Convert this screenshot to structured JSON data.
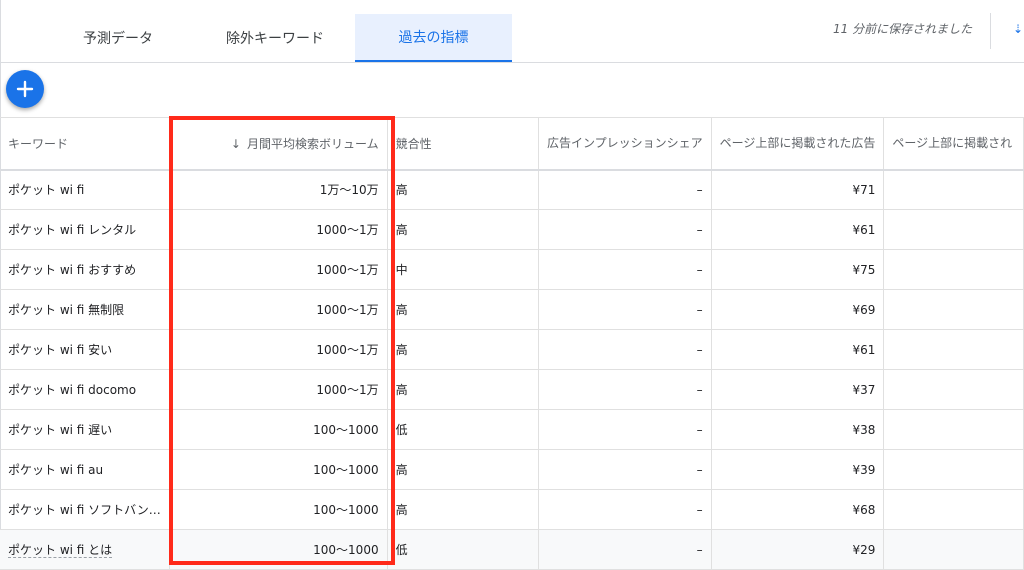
{
  "tabs": [
    {
      "label": "予測データ"
    },
    {
      "label": "除外キーワード"
    },
    {
      "label": "過去の指標"
    }
  ],
  "saved_status": "11 分前に保存されました",
  "colors": {
    "accent": "#1a73e8",
    "highlight": "#ff2a1a",
    "active_tab_bg": "#e8f0fe"
  },
  "table": {
    "headers": {
      "keyword": "キーワード",
      "volume": "月間平均検索ボリューム",
      "competition": "競合性",
      "impression_share": "広告インプレッションシェア",
      "top_bid_low": "ページ上部に掲載された広告",
      "top_bid_high": "ページ上部に掲載され"
    },
    "sort_icon": "arrow-down-icon",
    "rows": [
      {
        "keyword": "ポケット wi fi",
        "volume": "1万〜10万",
        "competition": "高",
        "share": "–",
        "bid": "¥71"
      },
      {
        "keyword": "ポケット wi fi レンタル",
        "volume": "1000〜1万",
        "competition": "高",
        "share": "–",
        "bid": "¥61"
      },
      {
        "keyword": "ポケット wi fi おすすめ",
        "volume": "1000〜1万",
        "competition": "中",
        "share": "–",
        "bid": "¥75"
      },
      {
        "keyword": "ポケット wi fi 無制限",
        "volume": "1000〜1万",
        "competition": "高",
        "share": "–",
        "bid": "¥69"
      },
      {
        "keyword": "ポケット wi fi 安い",
        "volume": "1000〜1万",
        "competition": "高",
        "share": "–",
        "bid": "¥61"
      },
      {
        "keyword": "ポケット wi fi docomo",
        "volume": "1000〜1万",
        "competition": "高",
        "share": "–",
        "bid": "¥37"
      },
      {
        "keyword": "ポケット wi fi 遅い",
        "volume": "100〜1000",
        "competition": "低",
        "share": "–",
        "bid": "¥38"
      },
      {
        "keyword": "ポケット wi fi au",
        "volume": "100〜1000",
        "competition": "高",
        "share": "–",
        "bid": "¥39"
      },
      {
        "keyword": "ポケット wi fi ソフトバン…",
        "volume": "100〜1000",
        "competition": "高",
        "share": "–",
        "bid": "¥68"
      },
      {
        "keyword": "ポケット wi fi とは",
        "volume": "100〜1000",
        "competition": "低",
        "share": "–",
        "bid": "¥29"
      }
    ]
  }
}
